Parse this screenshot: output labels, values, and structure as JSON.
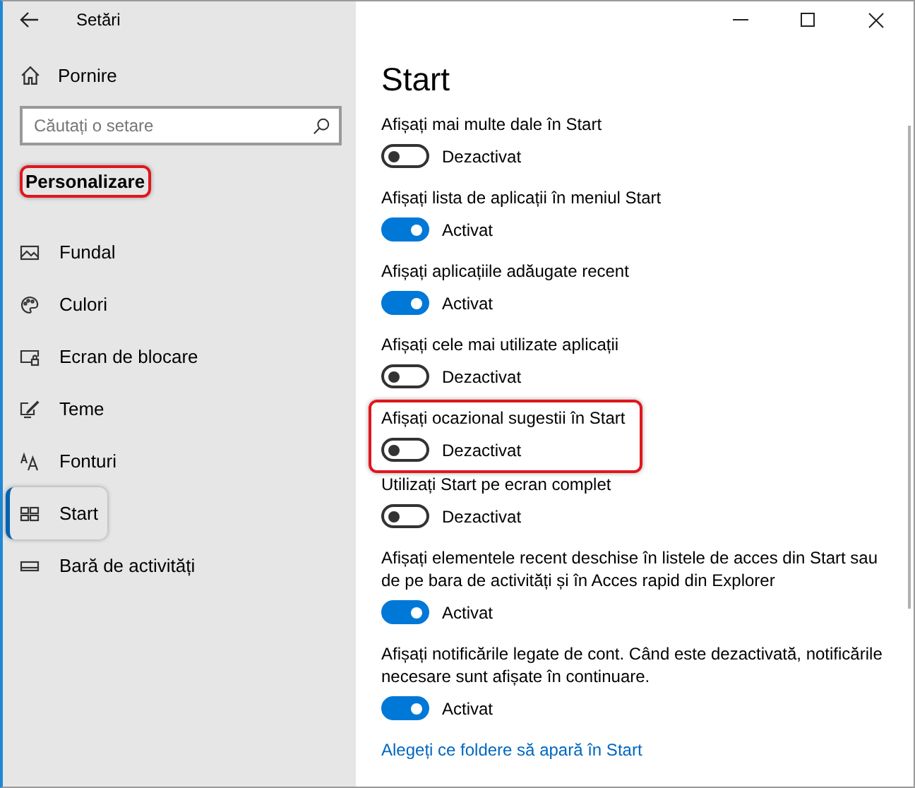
{
  "window": {
    "title": "Setări"
  },
  "sidebar": {
    "home": "Pornire",
    "search": {
      "placeholder": "Căutați o setare"
    },
    "section": {
      "label": "Personalizare",
      "highlighted": true
    },
    "items": [
      {
        "label": "Fundal",
        "selected": false,
        "highlighted": false
      },
      {
        "label": "Culori",
        "selected": false,
        "highlighted": false
      },
      {
        "label": "Ecran de blocare",
        "selected": false,
        "highlighted": false
      },
      {
        "label": "Teme",
        "selected": false,
        "highlighted": false
      },
      {
        "label": "Fonturi",
        "selected": false,
        "highlighted": false
      },
      {
        "label": "Start",
        "selected": true,
        "highlighted": true
      },
      {
        "label": "Bară de activități",
        "selected": false,
        "highlighted": false
      }
    ]
  },
  "page": {
    "title": "Start",
    "settings": [
      {
        "label": "Afișați mai multe dale în Start",
        "on": false,
        "state_text": "Dezactivat",
        "highlighted": false
      },
      {
        "label": "Afișați lista de aplicații în meniul Start",
        "on": true,
        "state_text": "Activat",
        "highlighted": false
      },
      {
        "label": "Afișați aplicațiile adăugate recent",
        "on": true,
        "state_text": "Activat",
        "highlighted": false
      },
      {
        "label": "Afișați cele mai utilizate aplicații",
        "on": false,
        "state_text": "Dezactivat",
        "highlighted": false
      },
      {
        "label": "Afișați ocazional sugestii în Start",
        "on": false,
        "state_text": "Dezactivat",
        "highlighted": true
      },
      {
        "label": "Utilizați Start pe ecran complet",
        "on": false,
        "state_text": "Dezactivat",
        "highlighted": false
      },
      {
        "label": "Afișați elementele recent deschise în listele de acces din Start sau de pe bara de activități și în Acces rapid din Explorer",
        "on": true,
        "state_text": "Activat",
        "highlighted": false
      },
      {
        "label": "Afișați notificările legate de cont. Când este dezactivată, notificările necesare sunt afișate în continuare.",
        "on": true,
        "state_text": "Activat",
        "highlighted": false
      }
    ],
    "link": "Alegeți ce foldere să apară în Start"
  }
}
